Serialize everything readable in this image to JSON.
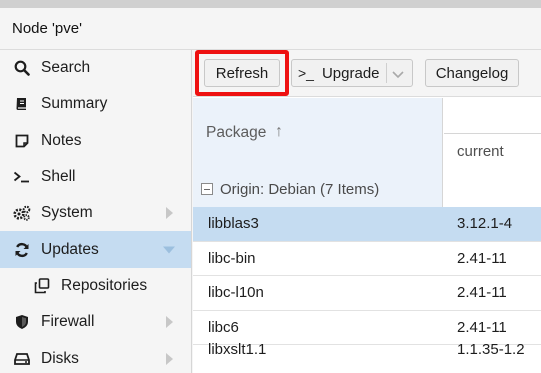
{
  "header": {
    "title": "Node 'pve'"
  },
  "sidebar": {
    "items": [
      {
        "label": "Search",
        "icon": "search-icon"
      },
      {
        "label": "Summary",
        "icon": "book-icon"
      },
      {
        "label": "Notes",
        "icon": "note-icon"
      },
      {
        "label": "Shell",
        "icon": "terminal-icon"
      },
      {
        "label": "System",
        "icon": "gears-icon"
      },
      {
        "label": "Updates",
        "icon": "refresh-icon"
      },
      {
        "label": "Repositories",
        "icon": "copy-icon"
      },
      {
        "label": "Firewall",
        "icon": "shield-icon"
      },
      {
        "label": "Disks",
        "icon": "disk-icon"
      }
    ]
  },
  "toolbar": {
    "refresh_label": "Refresh",
    "upgrade_label": "Upgrade",
    "upgrade_prefix": ">_",
    "changelog_label": "Changelog"
  },
  "grid": {
    "columns": {
      "package": "Package",
      "current": "current"
    },
    "group": "Origin: Debian (7 Items)",
    "rows": [
      {
        "package": "libblas3",
        "current": "3.12.1-4"
      },
      {
        "package": "libc-bin",
        "current": "2.41-11"
      },
      {
        "package": "libc-l10n",
        "current": "2.41-11"
      },
      {
        "package": "libc6",
        "current": "2.41-11"
      },
      {
        "package": "libxslt1.1",
        "current": "1.1.35-1.2"
      }
    ]
  },
  "colors": {
    "highlight": "#ee1111",
    "selected": "#c5dcf1",
    "header_bg": "#ebf2fa"
  }
}
